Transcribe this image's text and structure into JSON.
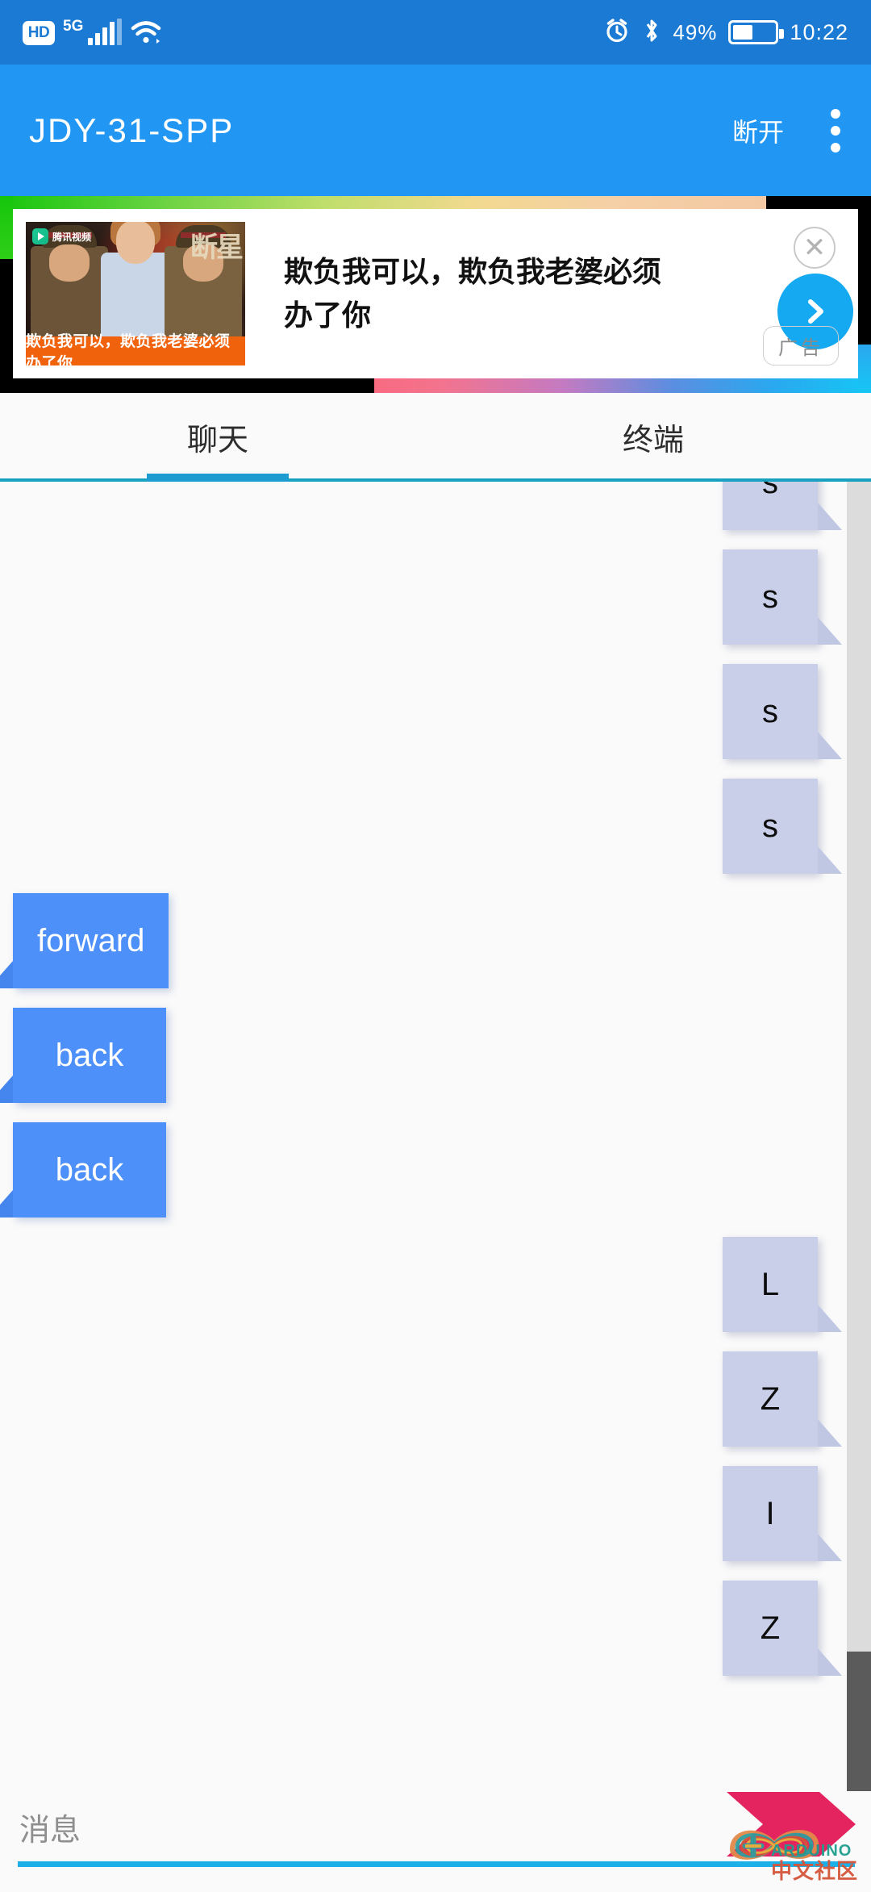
{
  "status_bar": {
    "hd_label": "HD",
    "network_label": "5G",
    "signal_icon": "signal-bars-icon",
    "wifi_icon": "wifi-icon",
    "alarm_icon": "alarm-clock-icon",
    "bluetooth_icon": "bluetooth-icon",
    "battery_percent": "49%",
    "battery_icon": "battery-icon",
    "time": "10:22"
  },
  "app_bar": {
    "title": "JDY-31-SPP",
    "disconnect_label": "断开",
    "menu_icon": "overflow-menu-icon"
  },
  "ad": {
    "headline": "欺负我可以，欺负我老婆必须办了你",
    "thumbnail_caption": "欺负我可以，欺负我老婆必须办了你",
    "brand": "腾讯视频",
    "poster_title": "断星",
    "close_icon": "close-circle-icon",
    "go_icon": "chevron-right-icon",
    "ad_badge": "广告"
  },
  "tabs": [
    {
      "label": "聊天",
      "active": true
    },
    {
      "label": "终端",
      "active": false
    }
  ],
  "messages": [
    {
      "text": "s",
      "side": "in"
    },
    {
      "text": "s",
      "side": "in"
    },
    {
      "text": "s",
      "side": "in"
    },
    {
      "text": "s",
      "side": "in"
    },
    {
      "text": "forward",
      "side": "out"
    },
    {
      "text": "back",
      "side": "out"
    },
    {
      "text": "back",
      "side": "out"
    },
    {
      "text": "L",
      "side": "in"
    },
    {
      "text": "Z",
      "side": "in"
    },
    {
      "text": "I",
      "side": "in"
    },
    {
      "text": "Z",
      "side": "in"
    }
  ],
  "input": {
    "placeholder": "消息",
    "value": "",
    "send_icon": "send-arrow-icon"
  },
  "watermark": {
    "en": "ARDUINO",
    "cn": "中文社区",
    "logo_icon": "arduino-infinity-icon"
  },
  "colors": {
    "status_bar": "#1b7ad4",
    "app_bar": "#2196f3",
    "tab_accent": "#1c9cd0",
    "tab_divider": "#18a0c0",
    "bubble_in": "#c9cfe8",
    "bubble_out": "#4d90fa",
    "input_underline": "#1bb0e8",
    "send_arrow": "#e4245f",
    "scrollbar_track": "#dcdcdc",
    "scrollbar_thumb": "#5b5b5b",
    "page_bg": "#fafafa"
  }
}
